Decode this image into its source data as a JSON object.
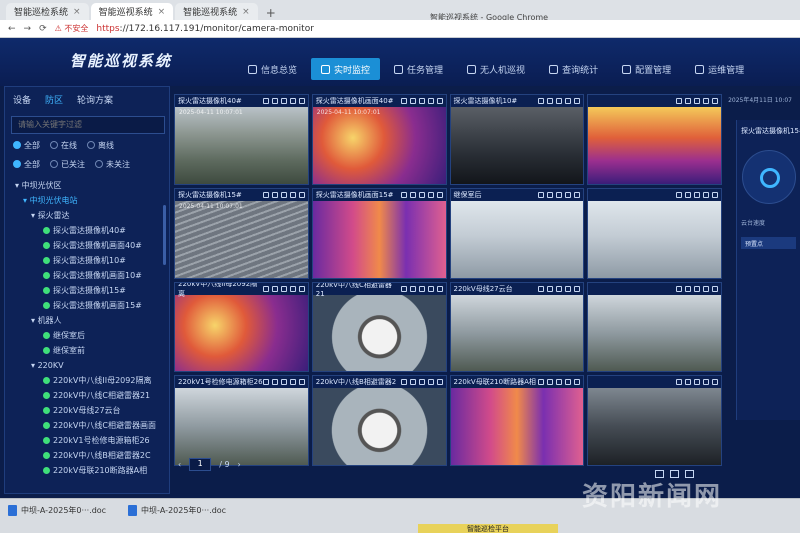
{
  "browser": {
    "tabs": [
      {
        "title": "智能巡检系统"
      },
      {
        "title": "智能巡视系统"
      },
      {
        "title": "智能巡视系统"
      }
    ],
    "window_title": "智能巡视系统 - Google Chrome",
    "security": "不安全",
    "url_scheme": "https",
    "url_rest": "://172.16.117.191/monitor/camera-monitor"
  },
  "app": {
    "logo": "智能巡视系统",
    "nav": [
      {
        "label": "信息总览",
        "active": false
      },
      {
        "label": "实时监控",
        "active": true
      },
      {
        "label": "任务管理",
        "active": false
      },
      {
        "label": "无人机巡视",
        "active": false
      },
      {
        "label": "查询统计",
        "active": false
      },
      {
        "label": "配置管理",
        "active": false
      },
      {
        "label": "运维管理",
        "active": false
      }
    ],
    "clock": "2025年4月11日 10:07"
  },
  "sidebar": {
    "tabs": [
      "设备",
      "防区",
      "轮询方案"
    ],
    "search_placeholder": "请输入关键字过滤",
    "status_filters": [
      "全部",
      "在线",
      "离线"
    ],
    "follow_filters": [
      "全部",
      "已关注",
      "未关注"
    ],
    "tree": {
      "root": "中坝光伏区",
      "station": "中坝光伏电站",
      "group1": "探火雷达",
      "group1_items": [
        "探火雷达摄像机40#",
        "探火雷达摄像机画面40#",
        "探火雷达摄像机10#",
        "探火雷达摄像机画面10#",
        "探火雷达摄像机15#",
        "探火雷达摄像机画面15#"
      ],
      "group2": "机器人",
      "group2_items": [
        "继保室后",
        "继保室前"
      ],
      "group3": "220KV",
      "group3_items": [
        "220kV中八线II母2092隔离",
        "220kV中八线C相避雷器21",
        "220kV母线27云台",
        "220kV中八线C相避雷器画面",
        "220kV1号检修电源箱柜26",
        "220kV中八线B相避雷器2C",
        "220kV母联210断路器A相"
      ]
    }
  },
  "grid": [
    {
      "title": "探火雷达摄像机40#",
      "feed": "mountain",
      "ts": "2025-04-11 10:07:01"
    },
    {
      "title": "探火雷达摄像机画面40#",
      "feed": "thermal",
      "ts": "2025-04-11 10:07:01"
    },
    {
      "title": "探火雷达摄像机10#",
      "feed": "dark",
      "ts": ""
    },
    {
      "title": "",
      "feed": "thermal3",
      "ts": ""
    },
    {
      "title": "探火雷达摄像机15#",
      "feed": "solar",
      "ts": "2025-04-11 10:07:01"
    },
    {
      "title": "探火雷达摄像机画面15#",
      "feed": "thermal2",
      "ts": ""
    },
    {
      "title": "继保室后",
      "feed": "indoor",
      "ts": ""
    },
    {
      "title": "",
      "feed": "indoor",
      "ts": ""
    },
    {
      "title": "220kV中八线II母2092隔离",
      "feed": "thermal",
      "ts": ""
    },
    {
      "title": "220kV中八线C相避雷器21",
      "feed": "gauge",
      "ts": ""
    },
    {
      "title": "220kV母线27云台",
      "feed": "sub",
      "ts": ""
    },
    {
      "title": "",
      "feed": "sub",
      "ts": ""
    },
    {
      "title": "220kV1号检修电源箱柜26",
      "feed": "sub",
      "ts": ""
    },
    {
      "title": "220kV中八线B相避雷器2",
      "feed": "gauge",
      "ts": ""
    },
    {
      "title": "220kV母联210断路器A相",
      "feed": "thermal2",
      "ts": ""
    },
    {
      "title": "",
      "feed": "night",
      "ts": ""
    }
  ],
  "pager": {
    "prev": "‹",
    "current": "1",
    "total": "/ 9",
    "next": "›"
  },
  "right_panel": {
    "title": "探火雷达摄像机15#",
    "speed_label": "云台速度",
    "preset": "预置点"
  },
  "taskbar": {
    "item1": "中坝-A-2025年0···.doc",
    "item2": "中坝-A-2025年0···.doc"
  },
  "watermark": "资阳新闻网",
  "label_plate": "智能巡检平台"
}
